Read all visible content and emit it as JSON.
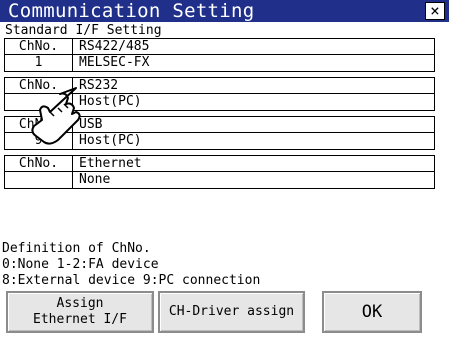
{
  "window": {
    "title": "Communication Setting",
    "close_glyph": "×"
  },
  "section_title": "Standard I/F Setting",
  "groups": [
    {
      "ch_header": "ChNo.",
      "header": "RS422/485",
      "ch_value": "1",
      "value": "MELSEC-FX"
    },
    {
      "ch_header": "ChNo.",
      "header": "RS232",
      "ch_value": "",
      "value": "Host(PC)"
    },
    {
      "ch_header": "ChNo.",
      "header": "USB",
      "ch_value": "9",
      "value": "Host(PC)"
    },
    {
      "ch_header": "ChNo.",
      "header": "Ethernet",
      "ch_value": "",
      "value": "None"
    }
  ],
  "definition": {
    "line1": "Definition of ChNo.",
    "line2": "0:None 1-2:FA device",
    "line3": "8:External device 9:PC connection"
  },
  "buttons": {
    "assign_line1": "Assign",
    "assign_line2": "Ethernet I/F",
    "ch_driver": "CH-Driver assign",
    "ok": "OK"
  },
  "icons": {
    "hand": "touch-hand-icon",
    "close": "close-icon"
  }
}
